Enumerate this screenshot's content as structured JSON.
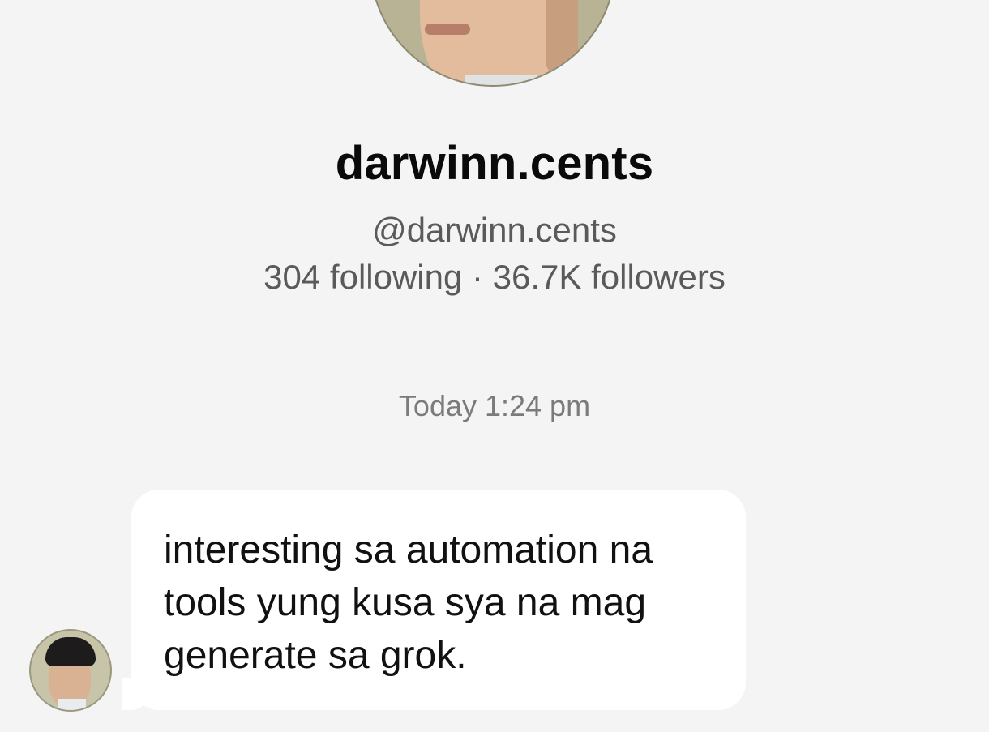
{
  "profile": {
    "display_name": "darwinn.cents",
    "username": "@darwinn.cents",
    "stats": "304 following · 36.7K followers"
  },
  "conversation": {
    "timestamp": "Today 1:24 pm",
    "messages": [
      {
        "text": "interesting sa automation na\ntools yung kusa sya na mag\ngenerate sa grok."
      }
    ]
  }
}
